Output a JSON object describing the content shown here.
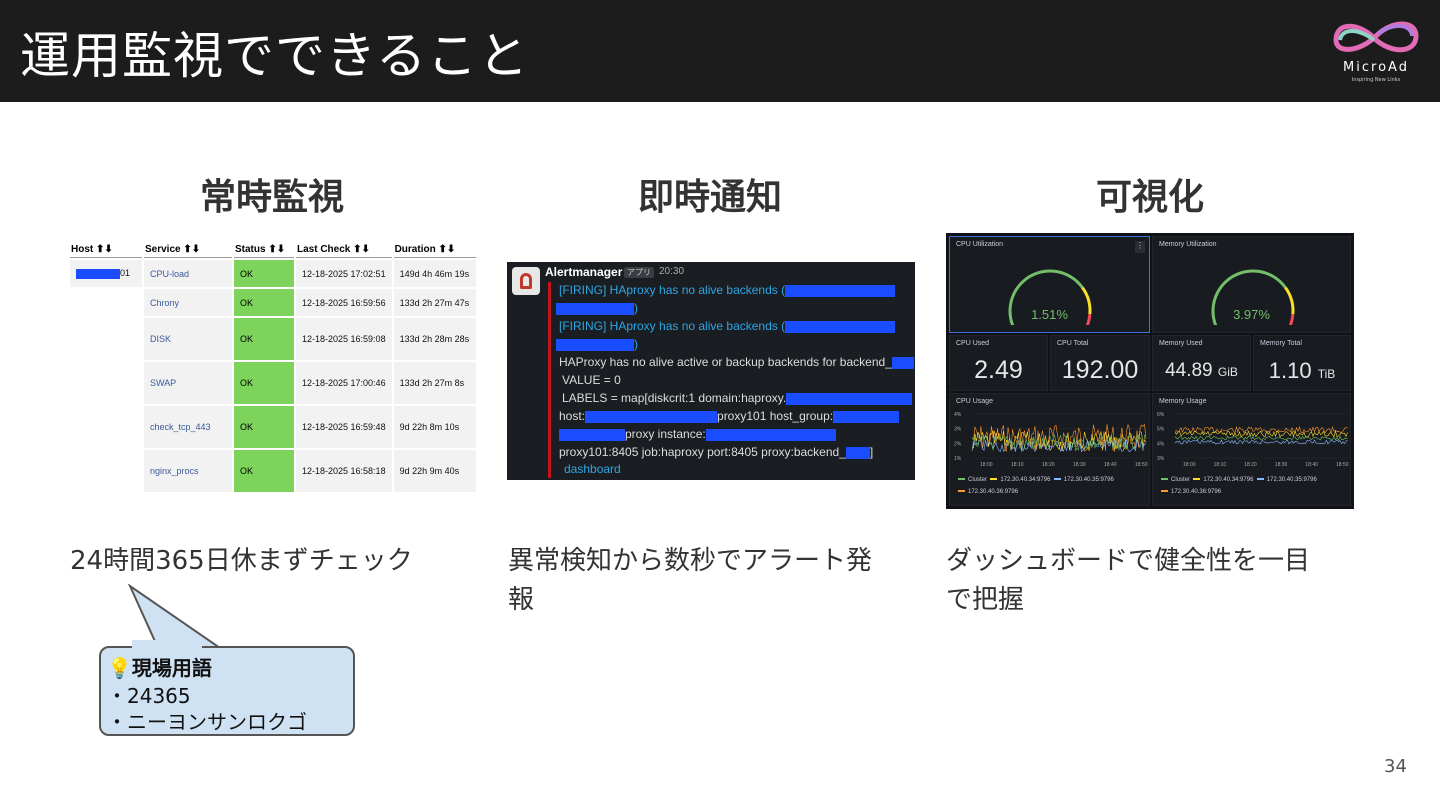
{
  "slide": {
    "title": "運用監視でできること",
    "page_number": "34",
    "logo": {
      "name": "MicroAd",
      "tagline": "Inspiring New Links"
    }
  },
  "columns": [
    {
      "heading": "常時監視",
      "caption": "24時間365日休まずチェック"
    },
    {
      "heading": "即時通知",
      "caption_line1": "異常検知から数秒でアラート発",
      "caption_line2": "報"
    },
    {
      "heading": "可視化",
      "caption_line1": "ダッシュボードで健全性を一目",
      "caption_line2": "で把握"
    }
  ],
  "callout": {
    "title": "💡現場用語",
    "line1": "・24365",
    "line2": "・ニーヨンサンロクゴ"
  },
  "nagios": {
    "headers": [
      "Host",
      "Service",
      "Status",
      "Last Check",
      "Duration"
    ],
    "host_suffix": "01",
    "rows": [
      {
        "service": "CPU-load",
        "status": "OK",
        "last_check": "12-18-2025 17:02:51",
        "duration": "149d 4h 46m 19s"
      },
      {
        "service": "Chrony",
        "status": "OK",
        "last_check": "12-18-2025 16:59:56",
        "duration": "133d 2h 27m 47s"
      },
      {
        "service": "DISK",
        "status": "OK",
        "last_check": "12-18-2025 16:59:08",
        "duration": "133d 2h 28m 28s"
      },
      {
        "service": "SWAP",
        "status": "OK",
        "last_check": "12-18-2025 17:00:46",
        "duration": "133d 2h 27m 8s"
      },
      {
        "service": "check_tcp_443",
        "status": "OK",
        "last_check": "12-18-2025 16:59:48",
        "duration": "9d 22h 8m 10s"
      },
      {
        "service": "nginx_procs",
        "status": "OK",
        "last_check": "12-18-2025 16:58:18",
        "duration": "9d 22h 9m 40s"
      }
    ]
  },
  "alertmanager": {
    "sender": "Alertmanager",
    "badge": "アプリ",
    "time": "20:30",
    "firing1": "[FIRING] HAproxy has no alive backends (",
    "paren": ")",
    "firing2": "[FIRING] HAproxy has no alive backends (",
    "desc": "HAProxy has no alive active or backup backends for backend_",
    "value": "VALUE = 0",
    "labels": "LABELS = map[diskcrit:1 domain:haproxy.",
    "host_prefix": "host:",
    "host_mid": "proxy101 host_group:",
    "instance": "proxy instance:",
    "job_line": "proxy101:8405 job:haproxy port:8405 proxy:backend_",
    "bracket": "]",
    "link": "dashboard"
  },
  "grafana": {
    "cpu_util": {
      "title": "CPU Utilization",
      "value": "1.51%",
      "fraction": 0.0151
    },
    "mem_util": {
      "title": "Memory Utilization",
      "value": "3.97%",
      "fraction": 0.0397
    },
    "cpu_used": {
      "title": "CPU Used",
      "value": "2.49"
    },
    "cpu_total": {
      "title": "CPU Total",
      "value": "192.00"
    },
    "mem_used": {
      "title": "Memory Used",
      "value": "44.89",
      "unit": "GiB"
    },
    "mem_total": {
      "title": "Memory Total",
      "value": "1.10",
      "unit": "TiB"
    },
    "cpu_usage": {
      "title": "CPU Usage",
      "yticks": [
        "4%",
        "3%",
        "2%",
        "1%"
      ]
    },
    "mem_usage": {
      "title": "Memory Usage",
      "yticks": [
        "6%",
        "5%",
        "4%",
        "3%"
      ]
    },
    "xticks": [
      "18:00",
      "18:10",
      "18:20",
      "18:30",
      "18:40",
      "18:50"
    ],
    "legend": [
      "Cluster",
      "172.30.40.34:9796",
      "172.30.40.35:9796",
      "172.30.40.36:9796"
    ],
    "colors": {
      "green": "#73bf69",
      "yellow": "#fade2a",
      "blue": "#8ab8ff",
      "orange": "#ff9830"
    }
  }
}
